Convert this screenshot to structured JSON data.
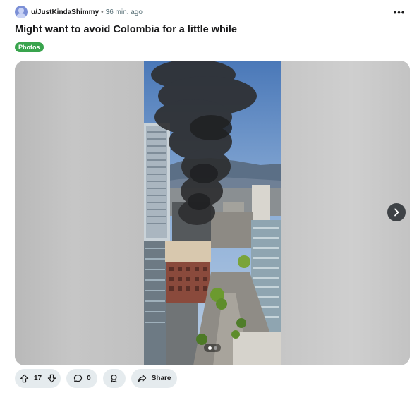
{
  "post": {
    "author": "u/JustKindaShimmy",
    "separator": "•",
    "time": "36 min. ago",
    "menu_label": "•••",
    "title": "Might want to avoid Colombia for a little while",
    "flair": "Photos"
  },
  "actions": {
    "vote_count": "17",
    "comment_count": "0",
    "share_label": "Share"
  },
  "icons": [
    "avatar",
    "more-options-icon",
    "chevron-right-icon",
    "upvote-icon",
    "downvote-icon",
    "comment-icon",
    "award-icon",
    "share-icon"
  ],
  "colors": {
    "flair_bg": "#39a44d",
    "pill_bg": "#e5ebee",
    "next_button_bg": "#3e4246"
  },
  "gallery": {
    "current_slide": 1,
    "total_slides": 2
  }
}
